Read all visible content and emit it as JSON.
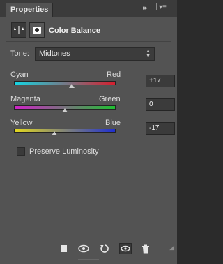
{
  "tabs": [
    {
      "label": "Properties"
    }
  ],
  "panel": {
    "collapse_glyph": "▸▸",
    "menu_glyph": "▾≡"
  },
  "header": {
    "title": "Color Balance"
  },
  "tone": {
    "label": "Tone:",
    "value": "Midtones"
  },
  "sliders": [
    {
      "left": "Cyan",
      "right": "Red",
      "value": "+17",
      "position": 0.57
    },
    {
      "left": "Magenta",
      "right": "Green",
      "value": "0",
      "position": 0.5
    },
    {
      "left": "Yellow",
      "right": "Blue",
      "value": "-17",
      "position": 0.4
    }
  ],
  "preserve": {
    "label": "Preserve Luminosity",
    "checked": false
  },
  "footer_icons": [
    "clip-to-layer-icon",
    "view-previous-state-icon",
    "reset-icon",
    "toggle-visibility-icon",
    "delete-icon"
  ]
}
